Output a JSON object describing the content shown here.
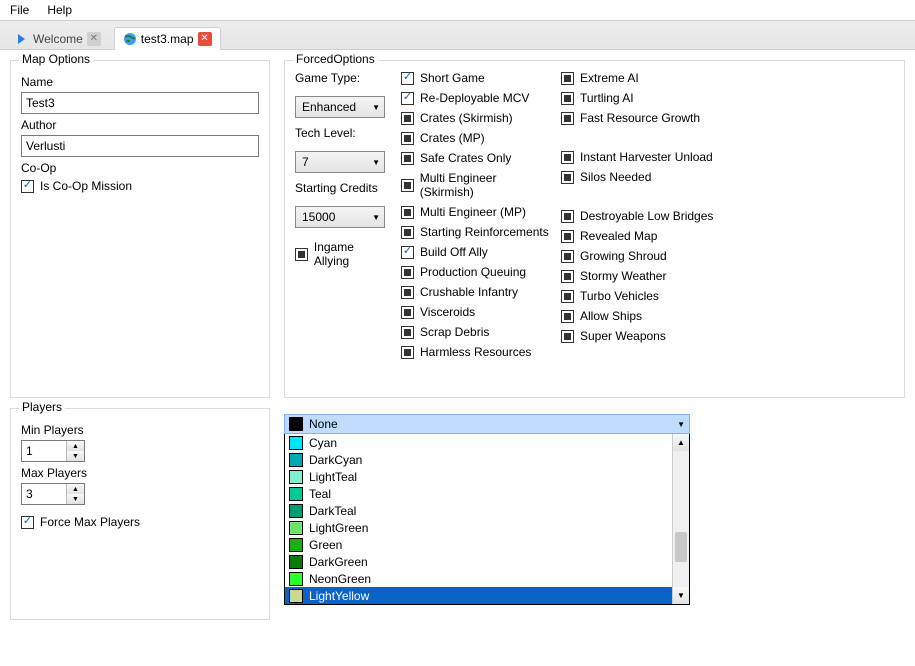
{
  "menu": {
    "file": "File",
    "help": "Help"
  },
  "tabs": {
    "welcome": "Welcome",
    "map": "test3.map"
  },
  "mapOptions": {
    "legend": "Map Options",
    "nameLabel": "Name",
    "nameValue": "Test3",
    "authorLabel": "Author",
    "authorValue": "Verlusti",
    "coopLabel": "Co-Op",
    "isCoop": "Is Co-Op Mission"
  },
  "forced": {
    "legend": "ForcedOptions",
    "gameTypeLabel": "Game Type:",
    "gameTypeValue": "Enhanced",
    "techLevelLabel": "Tech Level:",
    "techLevelValue": "7",
    "creditsLabel": "Starting Credits",
    "creditsValue": "15000",
    "ingameAllying": "Ingame Allying",
    "col1": [
      {
        "label": "Short Game",
        "state": "checked"
      },
      {
        "label": "Re-Deployable MCV",
        "state": "checked"
      },
      {
        "label": "Crates (Skirmish)",
        "state": "indet"
      },
      {
        "label": "Crates (MP)",
        "state": "indet"
      },
      {
        "label": "Safe Crates Only",
        "state": "indet"
      },
      {
        "label": "Multi Engineer (Skirmish)",
        "state": "indet"
      },
      {
        "label": "Multi Engineer (MP)",
        "state": "indet"
      },
      {
        "label": "Starting Reinforcements",
        "state": "indet"
      },
      {
        "label": "Build Off Ally",
        "state": "checked"
      },
      {
        "label": "Production Queuing",
        "state": "indet"
      },
      {
        "label": "Crushable Infantry",
        "state": "indet"
      },
      {
        "label": "Visceroids",
        "state": "indet"
      },
      {
        "label": "Scrap Debris",
        "state": "indet"
      },
      {
        "label": "Harmless Resources",
        "state": "indet"
      }
    ],
    "col2": [
      {
        "label": "Extreme AI",
        "state": "indet"
      },
      {
        "label": "Turtling AI",
        "state": "indet"
      },
      {
        "label": "Fast Resource Growth",
        "state": "indet"
      },
      {
        "label": "",
        "state": "none"
      },
      {
        "label": "Instant Harvester Unload",
        "state": "indet"
      },
      {
        "label": "Silos Needed",
        "state": "indet"
      },
      {
        "label": "",
        "state": "none"
      },
      {
        "label": "Destroyable Low Bridges",
        "state": "indet"
      },
      {
        "label": "Revealed Map",
        "state": "indet"
      },
      {
        "label": "Growing Shroud",
        "state": "indet"
      },
      {
        "label": "Stormy Weather",
        "state": "indet"
      },
      {
        "label": "Turbo Vehicles",
        "state": "indet"
      },
      {
        "label": "Allow Ships",
        "state": "indet"
      },
      {
        "label": "Super Weapons",
        "state": "indet"
      }
    ]
  },
  "players": {
    "legend": "Players",
    "minLabel": "Min Players",
    "minValue": "1",
    "maxLabel": "Max Players",
    "maxValue": "3",
    "forceMax": "Force Max Players"
  },
  "colorDropdown": {
    "selected": "None",
    "selectedColor": "#000000",
    "items": [
      {
        "label": "Cyan",
        "color": "#00e5ff"
      },
      {
        "label": "DarkCyan",
        "color": "#00a8b5"
      },
      {
        "label": "LightTeal",
        "color": "#7ff0d0"
      },
      {
        "label": "Teal",
        "color": "#00c896"
      },
      {
        "label": "DarkTeal",
        "color": "#009c74"
      },
      {
        "label": "LightGreen",
        "color": "#6de36d"
      },
      {
        "label": "Green",
        "color": "#17b017"
      },
      {
        "label": "DarkGreen",
        "color": "#0c7a0c"
      },
      {
        "label": "NeonGreen",
        "color": "#2aff2a"
      },
      {
        "label": "LightYellow",
        "color": "#c8d88e"
      }
    ],
    "highlightIndex": 9
  }
}
